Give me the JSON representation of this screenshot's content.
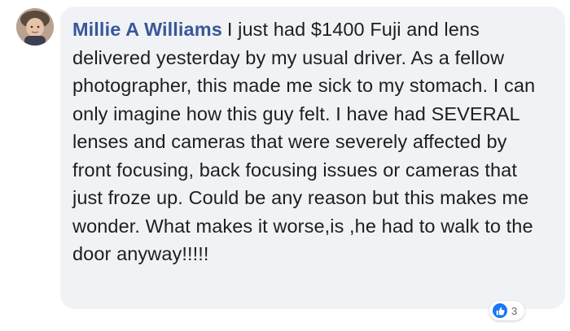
{
  "comment": {
    "author": "Millie A Williams",
    "text": "I just had $1400 Fuji and lens delivered yesterday by my usual driver. As a fellow photographer, this made me sick to my stomach. I can only imagine how this guy felt. I have had SEVERAL lenses and cameras that were severely affected by front focusing, back focusing issues or cameras that just froze up. Could be any reason but this makes me wonder. What makes it worse,is ,he had to walk to the door anyway!!!!!"
  },
  "reactions": {
    "icon": "like-icon",
    "count": "3"
  },
  "colors": {
    "author": "#385898",
    "bubble": "#f1f2f5",
    "like": "#1877f2",
    "text": "#1c1e21"
  }
}
